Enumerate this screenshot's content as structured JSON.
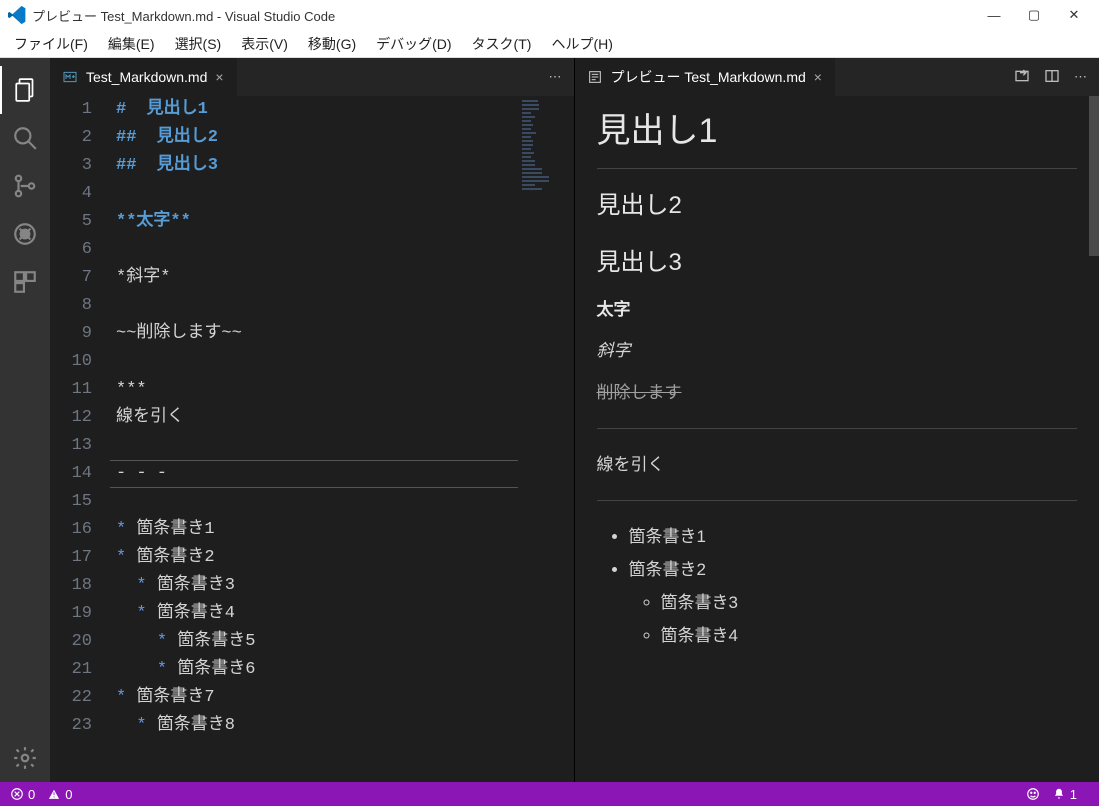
{
  "window": {
    "title": "プレビュー Test_Markdown.md - Visual Studio Code"
  },
  "menu": {
    "file": "ファイル(F)",
    "edit": "編集(E)",
    "select": "選択(S)",
    "view": "表示(V)",
    "go": "移動(G)",
    "debug": "デバッグ(D)",
    "task": "タスク(T)",
    "help": "ヘルプ(H)"
  },
  "tabs": {
    "left": {
      "label": "Test_Markdown.md"
    },
    "right": {
      "label": "プレビュー Test_Markdown.md"
    }
  },
  "editor": {
    "lines": [
      {
        "num": "1",
        "html": "<span class='tok-heading'># &nbsp;見出し1</span>"
      },
      {
        "num": "2",
        "html": "<span class='tok-heading'>## &nbsp;見出し2</span>"
      },
      {
        "num": "3",
        "html": "<span class='tok-heading'>## &nbsp;見出し3</span>"
      },
      {
        "num": "4",
        "html": ""
      },
      {
        "num": "5",
        "html": "<span class='tok-bold'>**太字**</span>"
      },
      {
        "num": "6",
        "html": ""
      },
      {
        "num": "7",
        "html": "<span class='tok-text'>*斜字*</span>"
      },
      {
        "num": "8",
        "html": ""
      },
      {
        "num": "9",
        "html": "<span class='tok-text'>~~削除します~~</span>"
      },
      {
        "num": "10",
        "html": ""
      },
      {
        "num": "11",
        "html": "<span class='tok-text'>***</span>"
      },
      {
        "num": "12",
        "html": "<span class='tok-text'>線を引く</span>"
      },
      {
        "num": "13",
        "html": ""
      },
      {
        "num": "14",
        "html": "<span class='tok-text'>- - -</span>"
      },
      {
        "num": "15",
        "html": ""
      },
      {
        "num": "16",
        "html": "<span class='tok-mark'>*</span> <span class='tok-text'>箇条書き1</span>"
      },
      {
        "num": "17",
        "html": "<span class='tok-mark'>*</span> <span class='tok-text'>箇条書き2</span>"
      },
      {
        "num": "18",
        "html": "&nbsp;&nbsp;<span class='tok-mark'>*</span> <span class='tok-text'>箇条書き3</span>"
      },
      {
        "num": "19",
        "html": "&nbsp;&nbsp;<span class='tok-mark'>*</span> <span class='tok-text'>箇条書き4</span>"
      },
      {
        "num": "20",
        "html": "&nbsp;&nbsp;&nbsp;&nbsp;<span class='tok-mark'>*</span> <span class='tok-text'>箇条書き5</span>"
      },
      {
        "num": "21",
        "html": "&nbsp;&nbsp;&nbsp;&nbsp;<span class='tok-mark'>*</span> <span class='tok-text'>箇条書き6</span>"
      },
      {
        "num": "22",
        "html": "<span class='tok-mark'>*</span> <span class='tok-text'>箇条書き7</span>"
      },
      {
        "num": "23",
        "html": "&nbsp;&nbsp;<span class='tok-mark'>*</span> <span class='tok-text'>箇条書き8</span>"
      }
    ],
    "cursor_line_index": 13
  },
  "preview": {
    "h1": "見出し1",
    "h2a": "見出し2",
    "h2b": "見出し3",
    "bold": "太字",
    "italic": "斜字",
    "strike": "削除します",
    "ruleText": "線を引く",
    "list": {
      "i1": "箇条書き1",
      "i2": "箇条書き2",
      "i3": "箇条書き3",
      "i4": "箇条書き4"
    }
  },
  "status": {
    "errors": "0",
    "warnings": "0",
    "notifications": "1"
  }
}
